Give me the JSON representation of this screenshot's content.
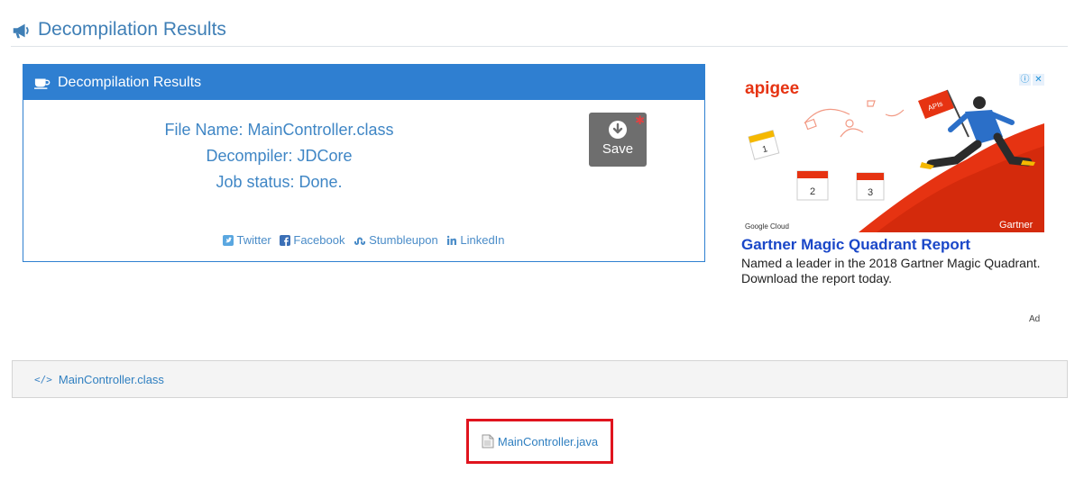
{
  "header": {
    "title": "Decompilation Results",
    "icon": "megaphone-icon"
  },
  "panel": {
    "title": "Decompilation Results",
    "icon": "coffee-cup-icon",
    "file_name": "File Name: MainController.class",
    "decompiler": "Decompiler: JDCore",
    "job_status": "Job status: Done.",
    "save_label": "Save",
    "share": {
      "twitter": "Twitter",
      "facebook": "Facebook",
      "stumbleupon": "Stumbleupon",
      "linkedin": "LinkedIn"
    }
  },
  "ad": {
    "brand": "apigee",
    "sponsor_logo": "Google Cloud",
    "partner": "Gartner",
    "flag_text": "APIs",
    "title": "Gartner Magic Quadrant Report",
    "description": "Named a leader in the 2018 Gartner Magic Quadrant. Download the report today.",
    "label": "Ad",
    "calendar_days": [
      "1",
      "2",
      "3"
    ]
  },
  "files": {
    "class_tab": "MainController.class",
    "class_tab_icon": "</>",
    "java_link": "MainController.java"
  },
  "colors": {
    "accent": "#2f7fd1",
    "link": "#3f86c5",
    "highlight": "#e0141e",
    "ad_red": "#e63312"
  }
}
